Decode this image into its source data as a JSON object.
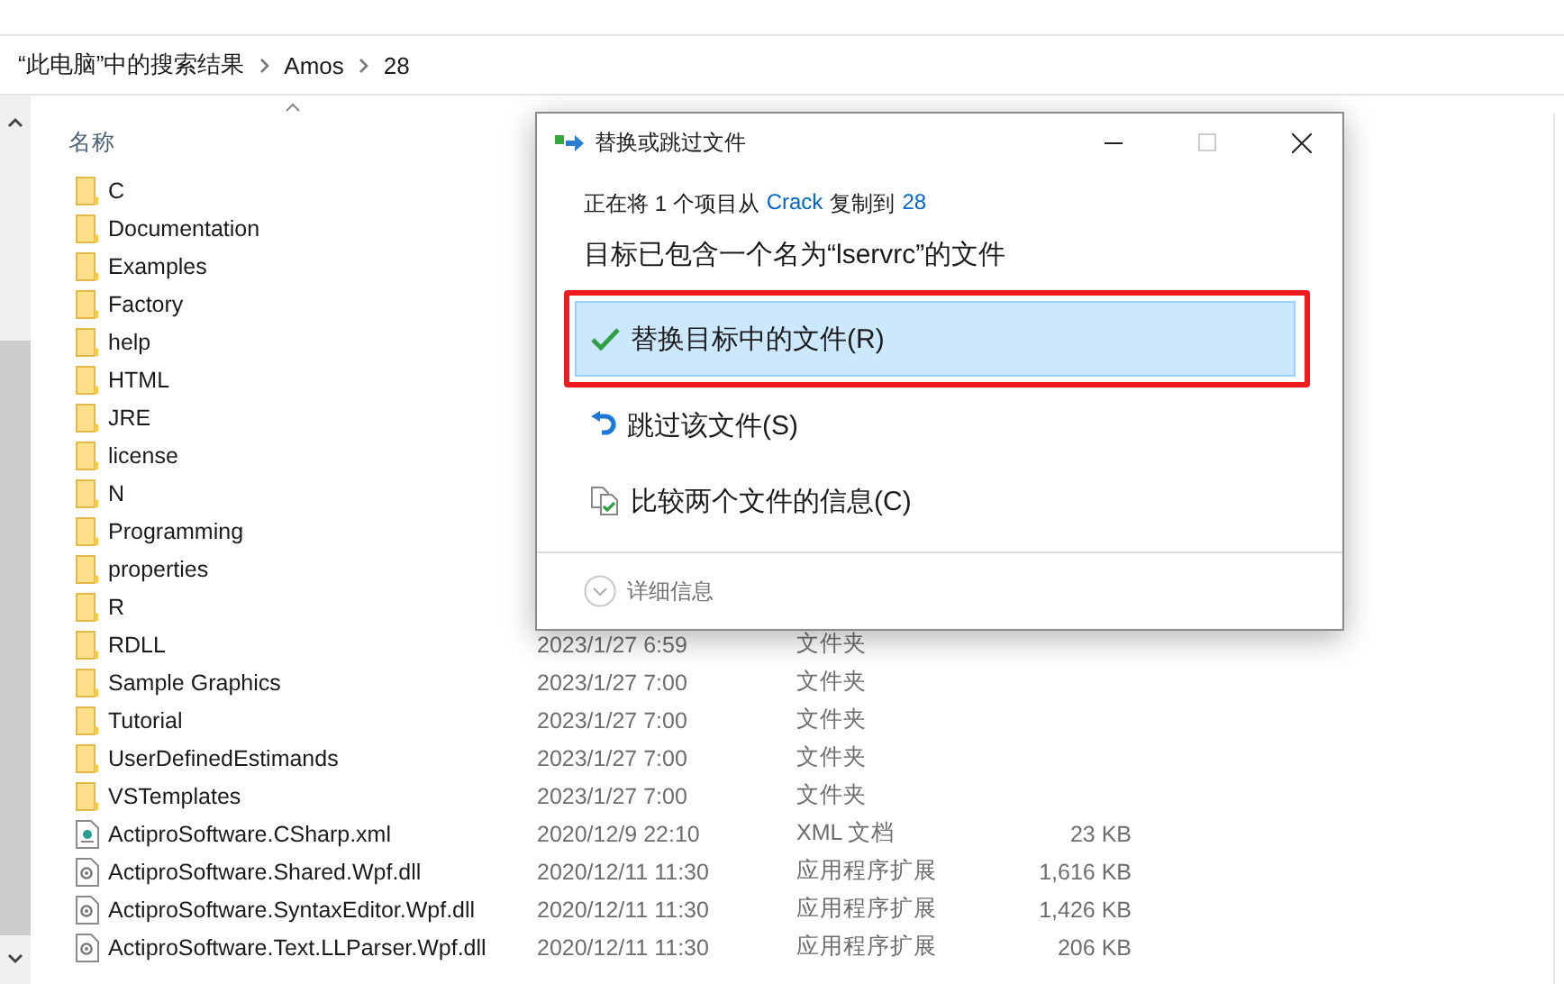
{
  "breadcrumb": [
    "“此电脑”中的搜索结果",
    "Amos",
    "28"
  ],
  "file_list": {
    "columns": [
      {
        "label": "名称"
      }
    ],
    "rows": [
      {
        "kind": "folder",
        "name": "C"
      },
      {
        "kind": "folder",
        "name": "Documentation"
      },
      {
        "kind": "folder",
        "name": "Examples"
      },
      {
        "kind": "folder",
        "name": "Factory"
      },
      {
        "kind": "folder",
        "name": "help"
      },
      {
        "kind": "folder",
        "name": "HTML"
      },
      {
        "kind": "folder",
        "name": "JRE"
      },
      {
        "kind": "folder",
        "name": "license"
      },
      {
        "kind": "folder",
        "name": "N"
      },
      {
        "kind": "folder",
        "name": "Programming"
      },
      {
        "kind": "folder",
        "name": "properties"
      },
      {
        "kind": "folder",
        "name": "R"
      },
      {
        "kind": "folder",
        "name": "RDLL",
        "date": "2023/1/27 6:59",
        "type": "文件夹"
      },
      {
        "kind": "folder",
        "name": "Sample Graphics",
        "date": "2023/1/27 7:00",
        "type": "文件夹"
      },
      {
        "kind": "folder",
        "name": "Tutorial",
        "date": "2023/1/27 7:00",
        "type": "文件夹"
      },
      {
        "kind": "folder",
        "name": "UserDefinedEstimands",
        "date": "2023/1/27 7:00",
        "type": "文件夹"
      },
      {
        "kind": "folder",
        "name": "VSTemplates",
        "date": "2023/1/27 7:00",
        "type": "文件夹"
      },
      {
        "kind": "xml",
        "name": "ActiproSoftware.CSharp.xml",
        "date": "2020/12/9 22:10",
        "type": "XML 文档",
        "size": "23 KB"
      },
      {
        "kind": "dll",
        "name": "ActiproSoftware.Shared.Wpf.dll",
        "date": "2020/12/11 11:30",
        "type": "应用程序扩展",
        "size": "1,616 KB"
      },
      {
        "kind": "dll",
        "name": "ActiproSoftware.SyntaxEditor.Wpf.dll",
        "date": "2020/12/11 11:30",
        "type": "应用程序扩展",
        "size": "1,426 KB"
      },
      {
        "kind": "dll",
        "name": "ActiproSoftware.Text.LLParser.Wpf.dll",
        "date": "2020/12/11 11:30",
        "type": "应用程序扩展",
        "size": "206 KB"
      }
    ]
  },
  "dialog": {
    "title": "替换或跳过文件",
    "status": {
      "prefix": "正在将 1 个项目从",
      "source": "Crack",
      "middle": "复制到",
      "target": "28"
    },
    "heading": "目标已包含一个名为“lservrc”的文件",
    "options": [
      {
        "kind": "replace",
        "label": "替换目标中的文件(R)",
        "selected": true,
        "annotated": true
      },
      {
        "kind": "skip",
        "label": "跳过该文件(S)",
        "selected": false,
        "annotated": false
      },
      {
        "kind": "compare",
        "label": "比较两个文件的信息(C)",
        "selected": false,
        "annotated": false
      }
    ],
    "details": "详细信息"
  }
}
